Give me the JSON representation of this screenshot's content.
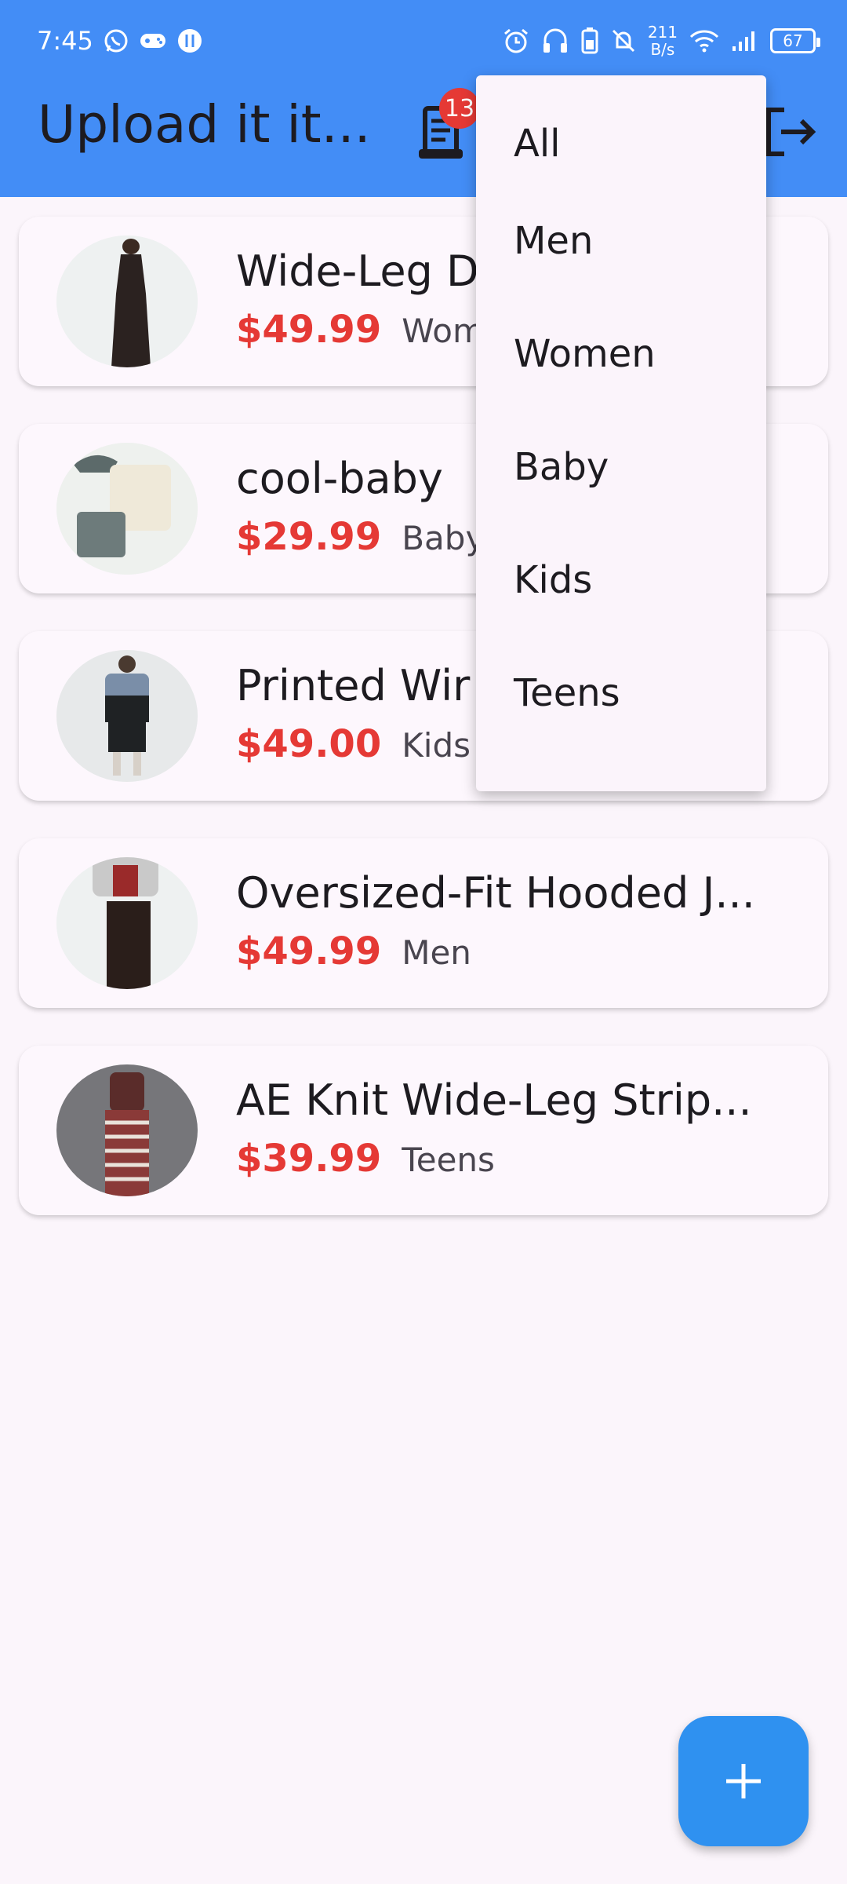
{
  "status_bar": {
    "time": "7:45",
    "net_speed_value": "211",
    "net_speed_unit": "B/s",
    "battery": "67"
  },
  "app_bar": {
    "title": "Upload it it...",
    "orders_badge_count": "13"
  },
  "products": [
    {
      "name": "Wide-Leg D",
      "price": "$49.99",
      "category": "Wome"
    },
    {
      "name": "cool-baby",
      "price": "$29.99",
      "category": "Baby"
    },
    {
      "name": "Printed Wir",
      "price": "$49.00",
      "category": "Kids"
    },
    {
      "name": "Oversized-Fit Hooded J...",
      "price": "$49.99",
      "category": "Men"
    },
    {
      "name": "AE Knit Wide-Leg Strip...",
      "price": "$39.99",
      "category": "Teens"
    }
  ],
  "filter_menu": {
    "options": [
      "All",
      "Men",
      "Women",
      "Baby",
      "Kids",
      "Teens"
    ]
  },
  "fab": {
    "icon": "plus-icon"
  },
  "colors": {
    "app_bar": "#438df6",
    "price": "#e53935",
    "fab": "#2f91f0",
    "background": "#fbf5fb"
  }
}
